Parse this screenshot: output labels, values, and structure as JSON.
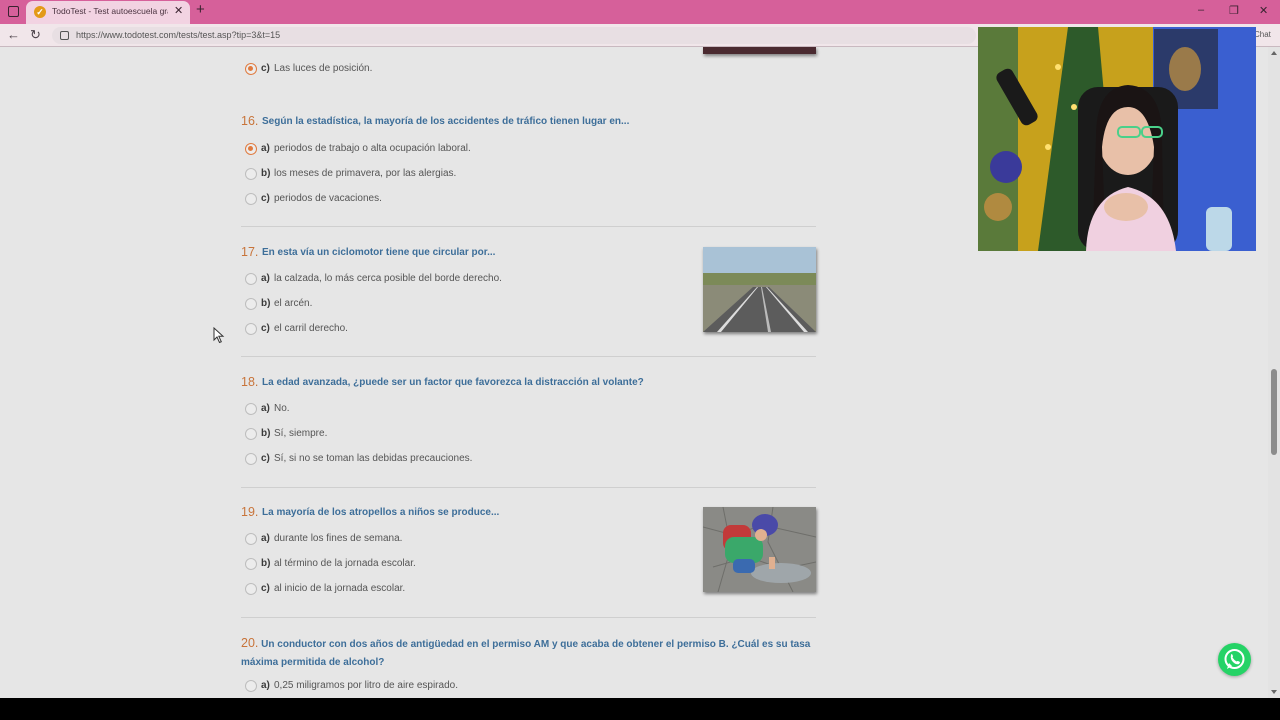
{
  "browser": {
    "tab_title": "TodoTest - Test autoescuela gratis",
    "tab_favicon": "✓",
    "url": "https://www.todotest.com/tests/test.asp?tip=3&t=15",
    "chat_label": "Chat",
    "accent_color": "#d6609a"
  },
  "top_option": {
    "letter": "c)",
    "text": "Las luces de posición.",
    "selected": true
  },
  "questions": [
    {
      "number": "16.",
      "text": "Según la estadística, la mayoría de los accidentes de tráfico tienen lugar en...",
      "options": [
        {
          "letter": "a)",
          "text": "periodos de trabajo o alta ocupación laboral.",
          "selected": true
        },
        {
          "letter": "b)",
          "text": "los meses de primavera, por las alergias.",
          "selected": false
        },
        {
          "letter": "c)",
          "text": "periodos de vacaciones.",
          "selected": false
        }
      ]
    },
    {
      "number": "17.",
      "text": "En esta vía un ciclomotor tiene que circular por...",
      "image": "road-photo",
      "options": [
        {
          "letter": "a)",
          "text": "la calzada, lo más cerca posible del borde derecho.",
          "selected": false
        },
        {
          "letter": "b)",
          "text": "el arcén.",
          "selected": false
        },
        {
          "letter": "c)",
          "text": "el carril derecho.",
          "selected": false
        }
      ]
    },
    {
      "number": "18.",
      "text": "La edad avanzada, ¿puede ser un factor que favorezca la distracción al volante?",
      "options": [
        {
          "letter": "a)",
          "text": "No.",
          "selected": false
        },
        {
          "letter": "b)",
          "text": "Sí, siempre.",
          "selected": false
        },
        {
          "letter": "c)",
          "text": "Sí, si no se toman las debidas precauciones.",
          "selected": false
        }
      ]
    },
    {
      "number": "19.",
      "text": "La mayoría de los atropellos a niños se produce...",
      "image": "child-puddle-photo",
      "options": [
        {
          "letter": "a)",
          "text": "durante los fines de semana.",
          "selected": false
        },
        {
          "letter": "b)",
          "text": "al término de la jornada escolar.",
          "selected": false
        },
        {
          "letter": "c)",
          "text": "al inicio de la jornada escolar.",
          "selected": false
        }
      ]
    },
    {
      "number": "20.",
      "text": "Un conductor con dos años de antigüedad en el permiso AM y que acaba de obtener el permiso B. ¿Cuál es su tasa máxima permitida de alcohol?",
      "options": [
        {
          "letter": "a)",
          "text": "0,25 miligramos por litro de aire espirado.",
          "selected": false
        }
      ]
    }
  ],
  "colors": {
    "question_text": "#3d6e99",
    "question_number": "#c8743a",
    "radio_selected": "#e07a3f",
    "whatsapp": "#25d366"
  },
  "icons": [
    "back-arrow-icon",
    "reload-icon",
    "lock-icon",
    "whatsapp-icon",
    "cursor-icon"
  ]
}
